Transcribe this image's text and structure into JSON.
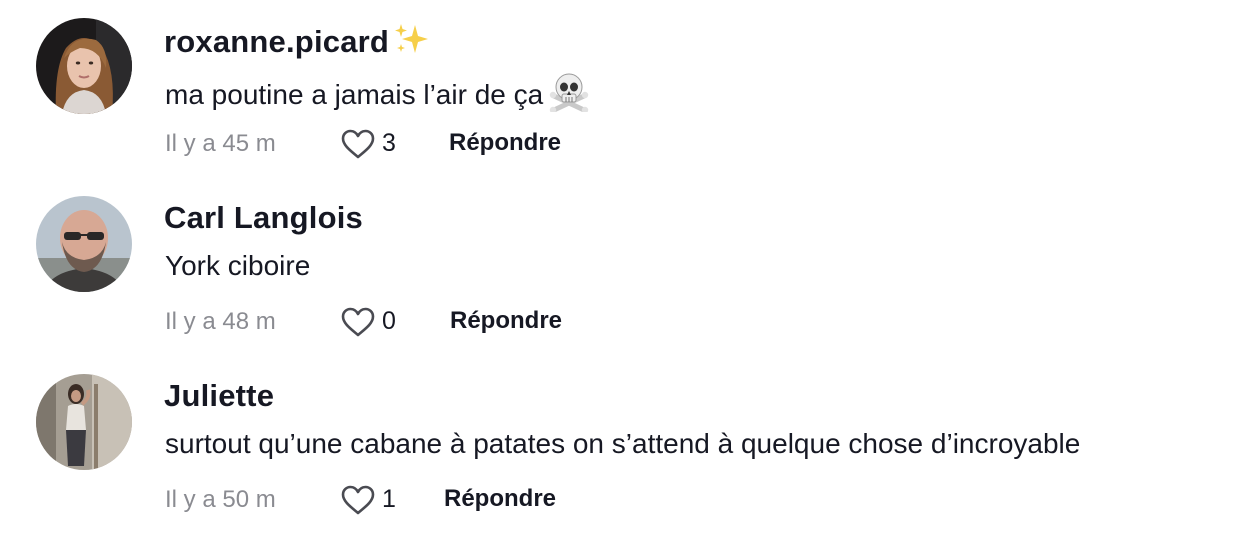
{
  "comments": [
    {
      "username": "roxanne.picard",
      "username_emoji": "sparkles-emoji",
      "text": "ma poutine a jamais l’air de ça",
      "text_emoji": "skull-and-crossbones-emoji",
      "time": "Il y a 45 m",
      "likes": "3",
      "reply_label": "Répondre"
    },
    {
      "username": "Carl Langlois",
      "text": "York ciboire",
      "time": "Il y a 48 m",
      "likes": "0",
      "reply_label": "Répondre"
    },
    {
      "username": "Juliette",
      "text": "surtout qu’une cabane à patates on s’attend à quelque chose d’incroyable",
      "time": "Il y a 50 m",
      "likes": "1",
      "reply_label": "Répondre"
    }
  ],
  "icons": {
    "like": "heart-outline-icon"
  },
  "colors": {
    "text_primary": "#161823",
    "text_secondary": "#8a8b91"
  }
}
